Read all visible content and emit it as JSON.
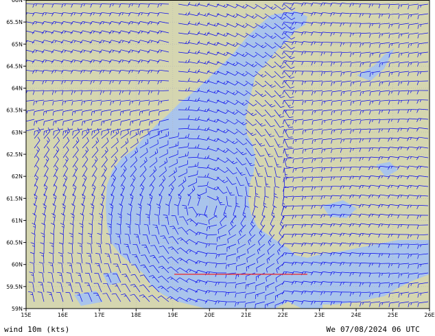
{
  "map": {
    "lat_labels": [
      "65.5N",
      "65N",
      "64.5N",
      "64N",
      "63.5N",
      "63N",
      "62.5N",
      "62N",
      "61.5N",
      "61N",
      "60.5N",
      "60N",
      "59.5N",
      "59N"
    ],
    "lat_values": [
      65.5,
      65,
      64.5,
      64,
      63.5,
      63,
      62.5,
      62,
      61.5,
      61,
      60.5,
      60,
      59.5,
      59
    ],
    "top_label": "66N",
    "lon_labels": [
      "15E",
      "16E",
      "17E",
      "18E",
      "19E",
      "20E",
      "21E",
      "22E",
      "23E",
      "24E",
      "25E",
      "26E"
    ],
    "lon_values": [
      15,
      16,
      17,
      18,
      19,
      20,
      21,
      22,
      23,
      24,
      25,
      26
    ],
    "colors": {
      "land": "#d5d6b0",
      "sea": "#a9c4ec",
      "barb": "#0000ee",
      "gridline": "#b4b4b4",
      "section_line": "#ee2222"
    }
  },
  "footer": {
    "left": "wind 10m (kts)",
    "right": "We 07/08/2024 06 UTC"
  }
}
